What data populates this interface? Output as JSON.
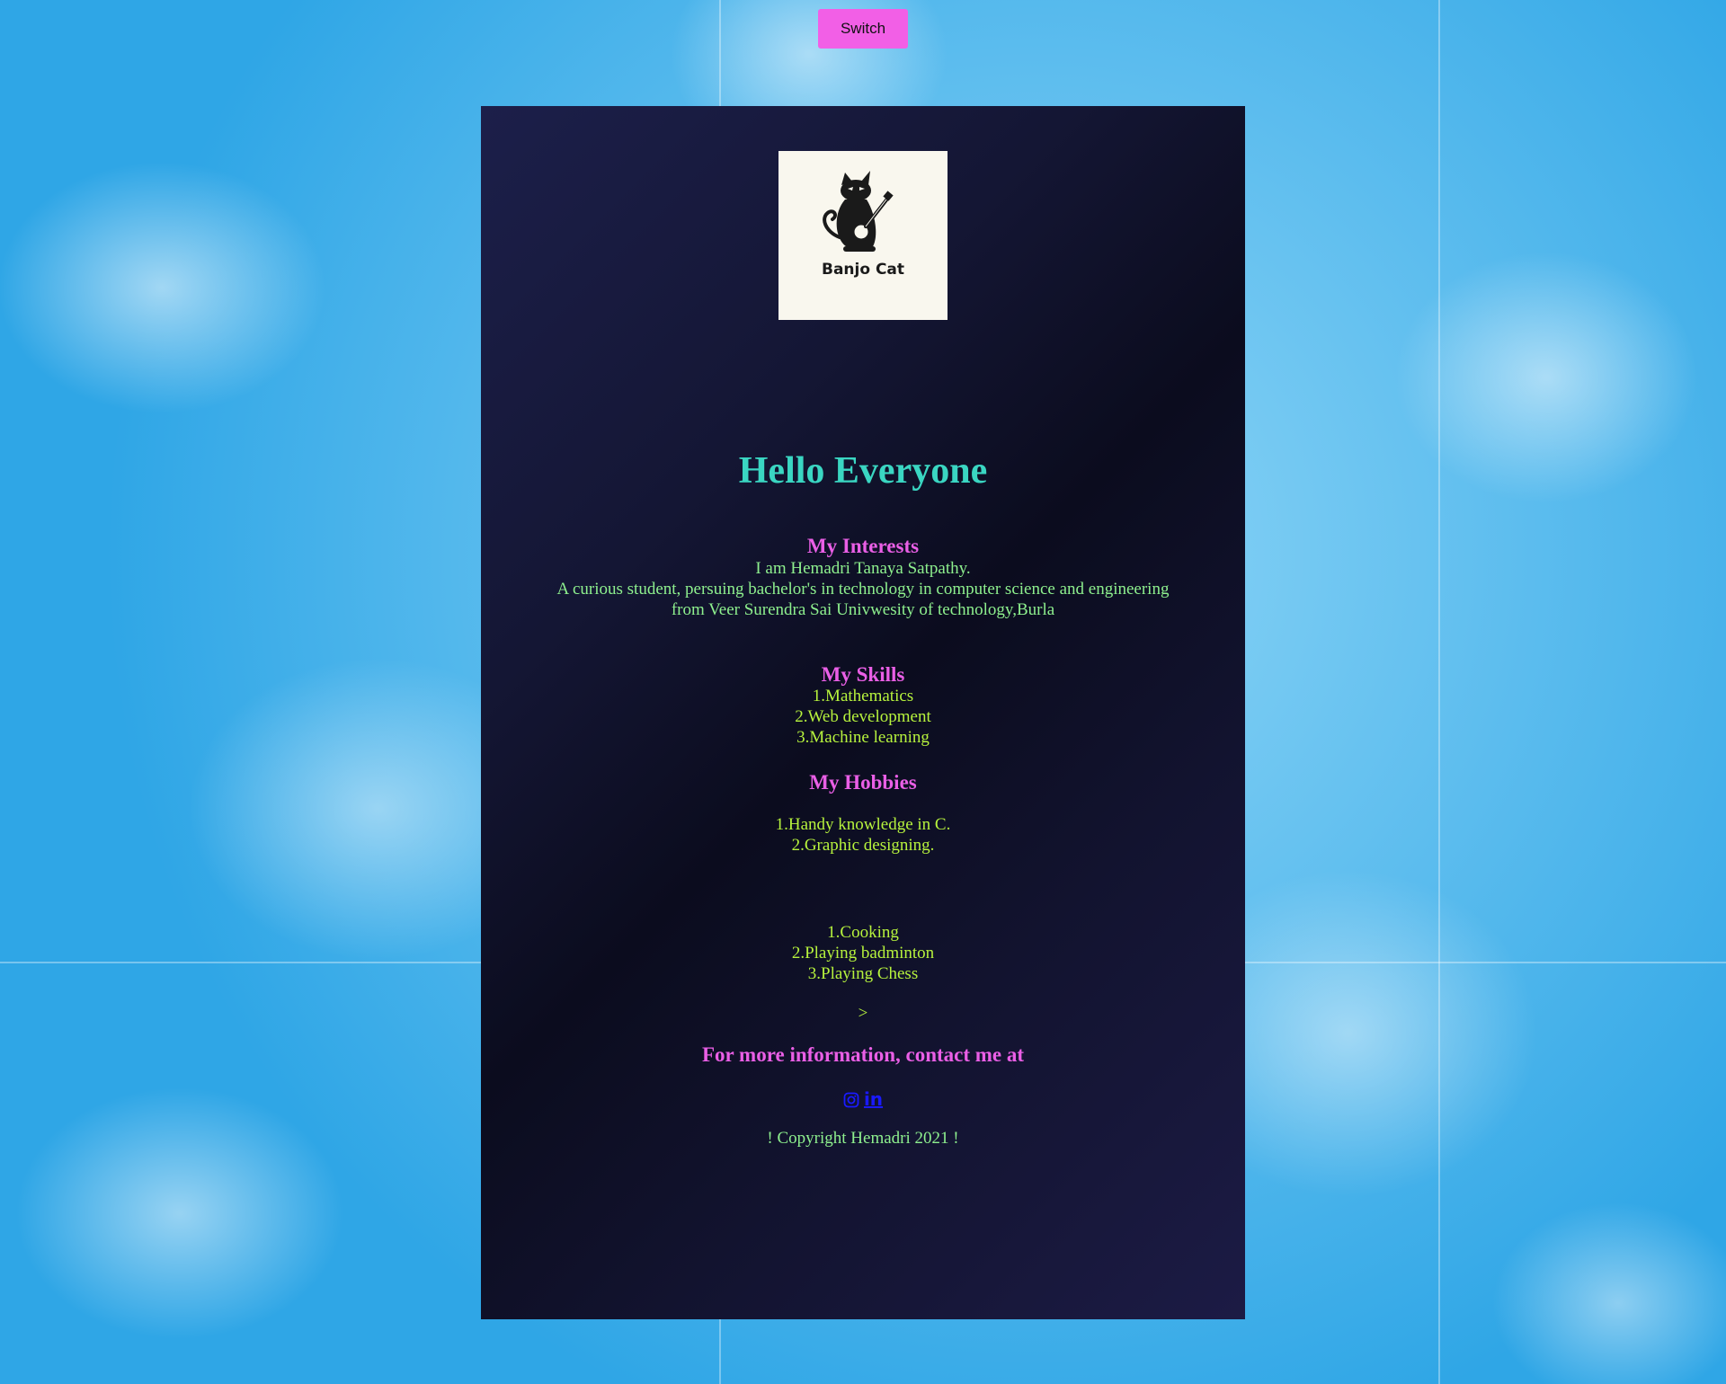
{
  "switch_button": {
    "label": "Switch"
  },
  "logo": {
    "text": "Banjo Cat"
  },
  "greeting": "Hello Everyone",
  "intro": {
    "line1": "I am Hemadri Tanaya Satpathy.",
    "line2": "A curious student, persuing bachelor's in technology in computer science and engineering",
    "line3": "from Veer Surendra Sai Univwesity of technology,Burla"
  },
  "interests": {
    "heading": "My Interests",
    "items": [
      "1.Mathematics",
      "2.Web development",
      "3.Machine learning"
    ]
  },
  "skills": {
    "heading": "My Skills",
    "items": [
      "1.Handy knowledge in C.",
      "2.Graphic designing."
    ]
  },
  "hobbies": {
    "heading": "My Hobbies",
    "items": [
      "1.Cooking",
      "2.Playing badminton",
      "3.Playing Chess"
    ]
  },
  "stray_text": ">",
  "contact": {
    "heading": "For more information, contact me at",
    "links": [
      {
        "icon": "instagram-icon",
        "text": ""
      },
      {
        "icon": "linkedin-icon",
        "text": "in"
      }
    ]
  },
  "copyright": "! Copyright Hemadri 2021 !",
  "colors": {
    "switch_button": "#f25fe6",
    "greeting": "#3ad6c2",
    "headings": "#ea5fe6",
    "list_text": "#b7f33d",
    "intro_text": "#8ef08e",
    "link": "#1a1aff"
  }
}
